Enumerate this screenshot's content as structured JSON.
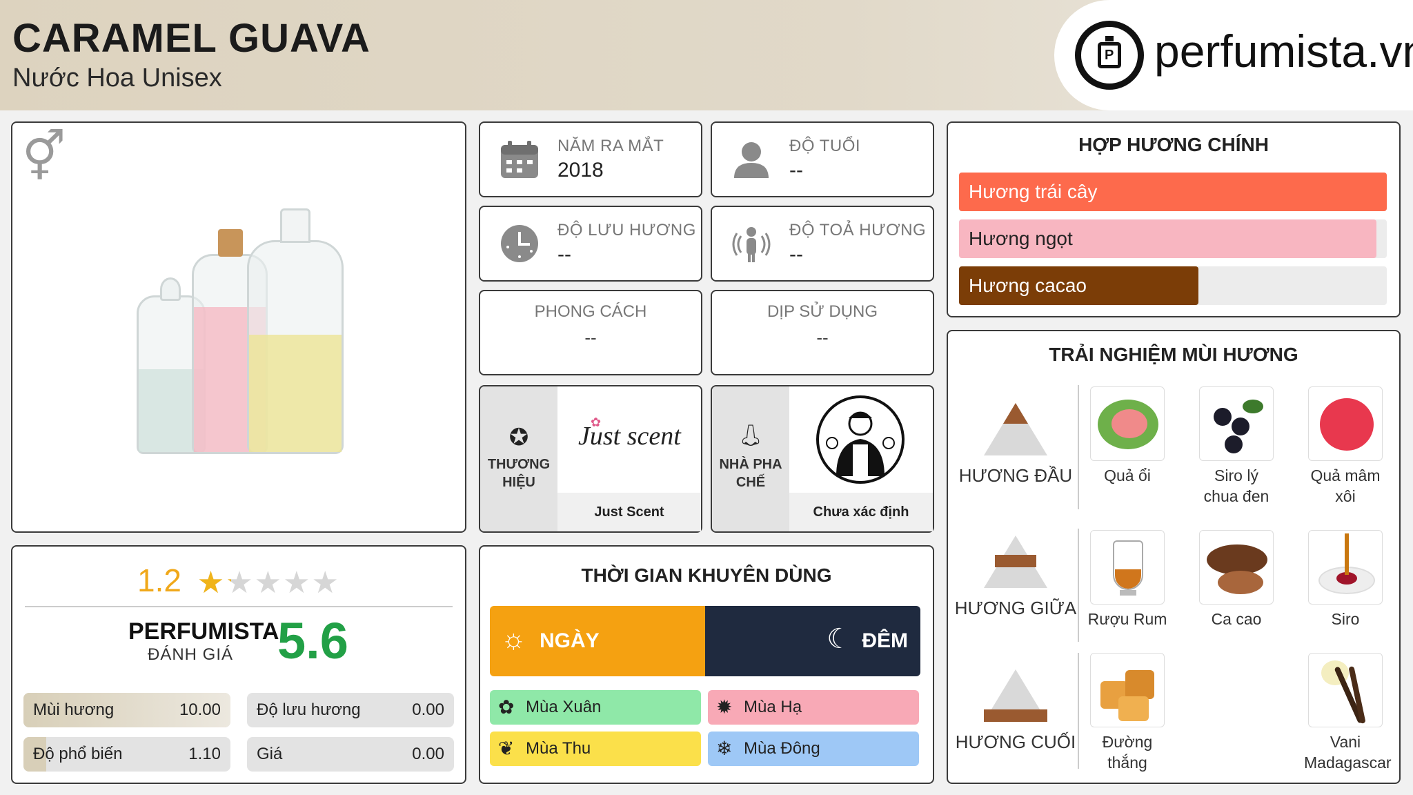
{
  "header": {
    "title": "CARAMEL GUAVA",
    "subtitle": "Nước Hoa Unisex",
    "logo_text": "perfumista.vn"
  },
  "info": {
    "launch_label": "NĂM RA MẮT",
    "launch_value": "2018",
    "age_label": "ĐỘ TUỔI",
    "age_value": "--",
    "longevity_label": "ĐỘ LƯU HƯƠNG",
    "longevity_value": "--",
    "sillage_label": "ĐỘ TOẢ HƯƠNG",
    "sillage_value": "--",
    "style_label": "PHONG CÁCH",
    "style_value": "--",
    "occasion_label": "DỊP SỬ DỤNG",
    "occasion_value": "--",
    "brand_label": "THƯƠNG HIỆU",
    "brand_name": "Just Scent",
    "brand_logo_text": "Just scent",
    "perfumer_label": "NHÀ PHA CHẾ",
    "perfumer_name": "Chưa xác định"
  },
  "rating": {
    "user_score": "1.2",
    "stars_value": 1.2,
    "stars_max": 5,
    "pf_label_a": "PERFUMISTA",
    "pf_label_b": "ĐÁNH GIÁ",
    "pf_score": "5.6",
    "metrics": [
      {
        "label": "Mùi hương",
        "value": "10.00",
        "fill": 1.0
      },
      {
        "label": "Độ lưu hương",
        "value": "0.00",
        "fill": 0.0
      },
      {
        "label": "Độ phổ biến",
        "value": "1.10",
        "fill": 0.11
      },
      {
        "label": "Giá",
        "value": "0.00",
        "fill": 0.0
      }
    ]
  },
  "time": {
    "title": "THỜI GIAN KHUYÊN DÙNG",
    "day": "NGÀY",
    "night": "ĐÊM",
    "spring": "Mùa Xuân",
    "summer": "Mùa Hạ",
    "autumn": "Mùa Thu",
    "winter": "Mùa Đông",
    "colors": {
      "day": "#f5a111",
      "night": "#1f2a3f",
      "spring": "#8fe8a8",
      "summer": "#f8a9b6",
      "autumn": "#fbe04a",
      "winter": "#9ec8f6"
    }
  },
  "accords": {
    "title": "HỢP HƯƠNG CHÍNH",
    "items": [
      {
        "label": "Hương trái cây",
        "fill": 1.0,
        "color": "#fd6a4c",
        "text_color": "#ffffff"
      },
      {
        "label": "Hương ngọt",
        "fill": 0.975,
        "color": "#f8b6c1",
        "text_color": "#222222"
      },
      {
        "label": "Hương cacao",
        "fill": 0.56,
        "color": "#7b3d07",
        "text_color": "#ffffff"
      }
    ]
  },
  "notes": {
    "title": "TRẢI NGHIỆM MÙI HƯƠNG",
    "top_label": "HƯƠNG ĐẦU",
    "middle_label": "HƯƠNG GIỮA",
    "base_label": "HƯƠNG CUỐI",
    "top": [
      "Quả ổi",
      "Siro lý chua đen",
      "Quả mâm xôi"
    ],
    "middle": [
      "Rượu Rum",
      "Ca cao",
      "Siro"
    ],
    "base": [
      "Đường thắng",
      "Vani Madagascar"
    ]
  }
}
